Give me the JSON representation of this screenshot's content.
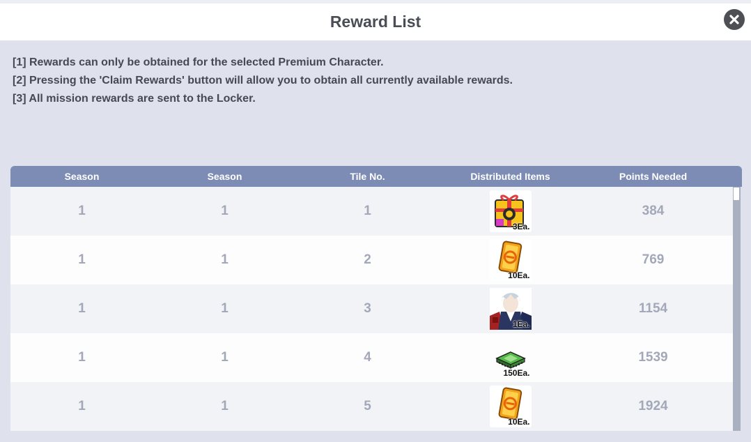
{
  "window": {
    "title": "Reward List"
  },
  "notes": [
    "[1] Rewards can only be obtained for the selected Premium Character.",
    "[2] Pressing the 'Claim Rewards' button will allow you to obtain all currently available rewards.",
    "[3] All mission rewards are sent to the Locker."
  ],
  "table": {
    "headers": [
      "Season",
      "Season",
      "Tile No.",
      "Distributed Items",
      "Points Needed"
    ],
    "rows": [
      {
        "season_a": "1",
        "season_b": "1",
        "tile": "1",
        "item_icon": "gift-box-icon",
        "qty": "3Ea.",
        "points": "384"
      },
      {
        "season_a": "1",
        "season_b": "1",
        "tile": "2",
        "item_icon": "ticket-icon",
        "qty": "10Ea.",
        "points": "769"
      },
      {
        "season_a": "1",
        "season_b": "1",
        "tile": "3",
        "item_icon": "character-portrait-icon",
        "qty": "1Ea.",
        "points": "1154"
      },
      {
        "season_a": "1",
        "season_b": "1",
        "tile": "4",
        "item_icon": "chip-icon",
        "qty": "150Ea.",
        "points": "1539"
      },
      {
        "season_a": "1",
        "season_b": "1",
        "tile": "5",
        "item_icon": "ticket-icon",
        "qty": "10Ea.",
        "points": "1924"
      }
    ]
  },
  "colors": {
    "header_bar": "#7d8cb4",
    "panel_bg": "#dfe2ec",
    "cell_text": "#a3a8b8",
    "close_button": "#4d4f55"
  }
}
